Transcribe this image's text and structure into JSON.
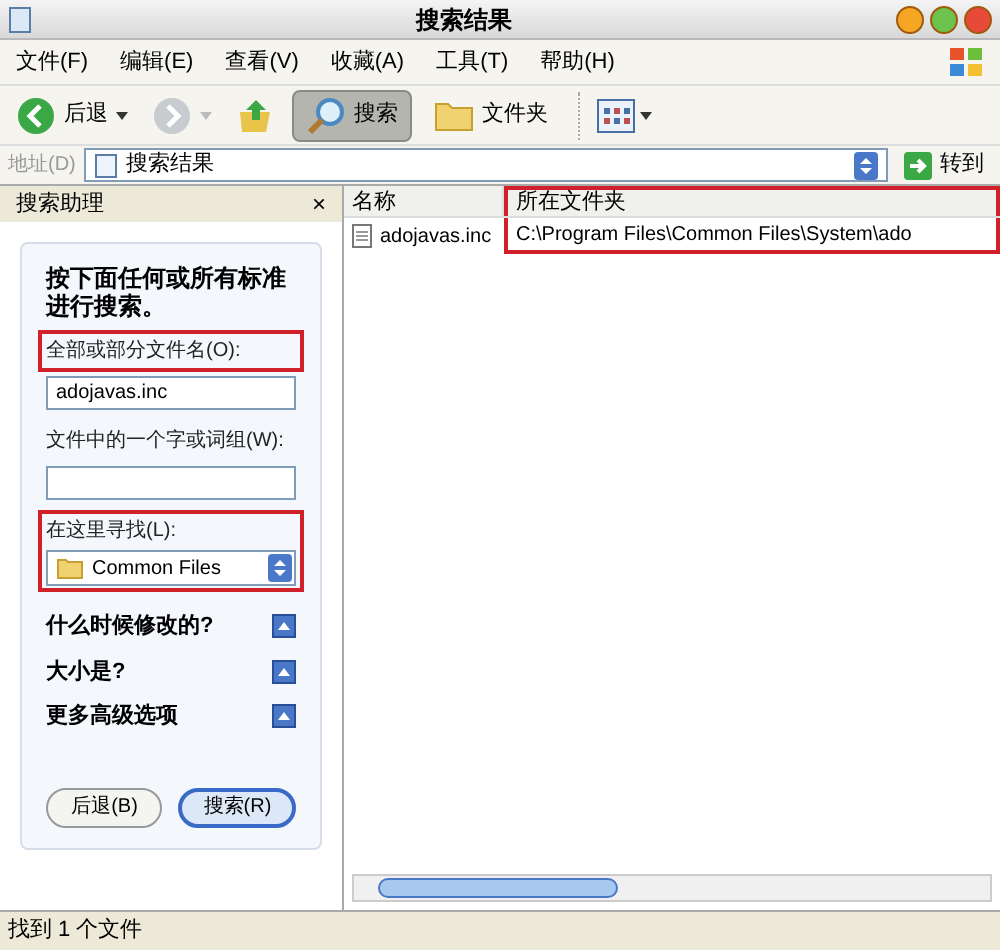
{
  "window": {
    "title": "搜索结果"
  },
  "menu": [
    "文件(F)",
    "编辑(E)",
    "查看(V)",
    "收藏(A)",
    "工具(T)",
    "帮助(H)"
  ],
  "toolbar": [
    {
      "kind": "back",
      "label": "后退",
      "disabled": false
    },
    {
      "kind": "forward",
      "disabled": true
    },
    {
      "kind": "up"
    },
    {
      "kind": "search",
      "label": "搜索",
      "selected": true
    },
    {
      "kind": "folders",
      "label": "文件夹",
      "selected": false
    },
    {
      "kind": "views"
    }
  ],
  "address": {
    "label": "地址(D)",
    "value": "搜索结果",
    "go": "转到"
  },
  "search_pane": {
    "title": "搜索助理",
    "close": "×",
    "heading": "按下面任何或所有标准进行搜索。",
    "fields": [
      {
        "kind": "text",
        "label": "全部或部分文件名(O):",
        "value": "adojavas.inc",
        "highlighted": true
      },
      {
        "kind": "text",
        "label": "文件中的一个字或词组(W):",
        "highlighted": false
      },
      {
        "kind": "dropdown",
        "label": "在这里寻找(L):",
        "value": "Common Files",
        "highlighted": true
      }
    ],
    "options": [
      {
        "label": "什么时候修改的?",
        "expanded": false
      },
      {
        "label": "大小是?",
        "expanded": false
      },
      {
        "label": "更多高级选项",
        "expanded": false
      }
    ],
    "buttons": [
      {
        "label": "后退(B)",
        "default": false
      },
      {
        "label": "搜索(R)",
        "default": true
      }
    ]
  },
  "results": {
    "columns": [
      {
        "label": "名称",
        "highlighted": false
      },
      {
        "label": "所在文件夹",
        "highlighted": true
      }
    ],
    "rows": [
      {
        "name": "adojavas.inc",
        "folder": "C:\\Program Files\\Common Files\\System\\ado"
      }
    ]
  },
  "status_bar": "找到 1 个文件"
}
